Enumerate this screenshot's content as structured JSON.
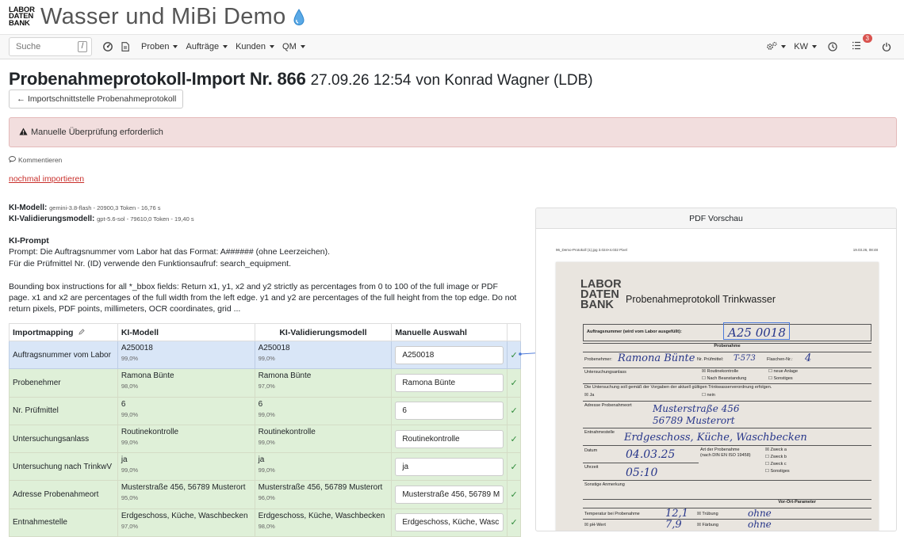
{
  "header": {
    "logo_line1": "LABOR",
    "logo_line2": "DATEN",
    "logo_line3": "BANK",
    "app_title": "Wasser und MiBi Demo"
  },
  "navbar": {
    "search_placeholder": "Suche",
    "search_key": "/",
    "menus": [
      "Proben",
      "Aufträge",
      "Kunden",
      "QM"
    ],
    "kw_label": "KW",
    "task_badge": "3",
    "icons": [
      "dashboard-icon",
      "document-icon",
      "settings-icon",
      "history-icon",
      "tasks-icon",
      "power-icon"
    ]
  },
  "page": {
    "title_main": "Probenahmeprotokoll-Import Nr. 866",
    "title_date": "27.09.26 12:54",
    "title_by": "von Konrad Wagner (LDB)",
    "back_button": "Importschnittstelle Probenahmeprotokoll",
    "alert_text": "Manuelle Überprüfung erforderlich",
    "comment_link": "Kommentieren",
    "reimport_link": "nochmal importieren"
  },
  "ai_info": {
    "model_label": "KI-Modell:",
    "model_value": "gemini-3.8-flash - 20900,3 Token - 16,76 s",
    "validation_label": "KI-Validierungsmodell:",
    "validation_value": "gpt-5.6-sol - 79610,0 Token - 19,40 s",
    "prompt_label": "KI-Prompt",
    "prompt_line1": "Prompt: Die Auftragsnummer vom Labor hat das Format: A###### (ohne Leerzeichen).",
    "prompt_line2": "Für die Prüfmittel Nr. (ID) verwende den Funktionsaufruf: search_equipment.",
    "prompt_line3": "Bounding box instructions for all *_bbox fields: Return x1, y1, x2 and y2 strictly as percentages from 0 to 100 of the full image or PDF page. x1 and x2 are percentages of the full width from the left edge. y1 and y2 are percentages of the full height from the top edge. Do not return pixels, PDF points, millimeters, OCR coordinates, grid ..."
  },
  "mapping_table": {
    "headers": [
      "Importmapping",
      "KI-Modell",
      "KI-Validierungsmodell",
      "Manuelle Auswahl"
    ],
    "rows": [
      {
        "field": "Auftragsnummer vom Labor",
        "model": "A250018",
        "model_pct": "99,0%",
        "val": "A250018",
        "val_pct": "99,0%",
        "manual": "A250018"
      },
      {
        "field": "Probenehmer",
        "model": "Ramona Bünte",
        "model_pct": "98,0%",
        "val": "Ramona Bünte",
        "val_pct": "97,0%",
        "manual": "Ramona Bünte"
      },
      {
        "field": "Nr. Prüfmittel",
        "model": "6",
        "model_pct": "99,0%",
        "val": "6",
        "val_pct": "99,0%",
        "manual": "6"
      },
      {
        "field": "Untersuchungsanlass",
        "model": "Routinekontrolle",
        "model_pct": "99,0%",
        "val": "Routinekontrolle",
        "val_pct": "99,0%",
        "manual": "Routinekontrolle"
      },
      {
        "field": "Untersuchung nach TrinkwV",
        "model": "ja",
        "model_pct": "99,0%",
        "val": "ja",
        "val_pct": "99,0%",
        "manual": "ja"
      },
      {
        "field": "Adresse Probenahmeort",
        "model": "Musterstraße 456, 56789 Musterort",
        "model_pct": "95,0%",
        "val": "Musterstraße 456, 56789 Musterort",
        "val_pct": "96,0%",
        "manual": "Musterstraße 456, 56789 M"
      },
      {
        "field": "Entnahmestelle",
        "model": "Erdgeschoss, Küche, Waschbecken",
        "model_pct": "97,0%",
        "val": "Erdgeschoss, Küche, Waschbecken",
        "val_pct": "98,0%",
        "manual": "Erdgeschoss, Küche, Wasc"
      }
    ]
  },
  "pdf_preview": {
    "heading": "PDF Vorschau",
    "file_label": "96_Demo-Protokoll (1).jpg 3.024×4.032 Pixel",
    "timestamp": "19.03.26, 08:48",
    "form_logo1": "LABOR",
    "form_logo2": "DATEN",
    "form_logo3": "BANK",
    "form_title": "Probenahmeprotokoll Trinkwasser",
    "order_label": "Auftragsnummer (wird vom Labor ausgefüllt):",
    "order_hand": "A25 0018",
    "section_probe": "Probenahme",
    "probenehmer_label": "Probenehmer:",
    "probenehmer_hand": "Ramona Bünte",
    "pruefmittel_label": "Nr. Prüfmittel:",
    "pruefmittel_hand": "T-573",
    "flaschen_label": "Flaschen-Nr.:",
    "flaschen_hand": "4",
    "anlass_label": "Untersuchungsanlass",
    "opt_routine": "Routinekontrolle",
    "opt_beanstandung": "Nach Beanstandung",
    "opt_neue": "neue Anlage",
    "opt_sonstiges": "Sonstiges",
    "trinkwv_text": "Die Untersuchung soll gemäß der Vorgaben der aktuell gültigen Trinkwasserverordnung erfolgen.",
    "ja_label": "Ja",
    "nein_label": "nein",
    "adresse_label": "Adresse Probenahmeort",
    "adresse_hand1": "Musterstraße 456",
    "adresse_hand2": "56789 Musterort",
    "entnahme_label": "Entnahmestelle",
    "entnahme_hand": "Erdgeschoss, Küche, Waschbecken",
    "datum_label": "Datum",
    "datum_hand": "04.03.25",
    "art_label": "Art der Probenahme",
    "art_label2": "(nach DIN EN ISO 19458)",
    "zweck_a": "Zweck a",
    "zweck_b": "Zweck b",
    "zweck_c": "Zweck c",
    "zweck_sonst": "Sonstiges",
    "uhrzeit_label": "Uhrzeit",
    "uhrzeit_hand": "05:10",
    "sonstige_label": "Sonstige Anmerkung",
    "vor_ort": "Vor-Ort-Parameter",
    "temp_label": "Temperatur bei Probenahme",
    "temp_hand": "12,1",
    "truebung_label": "Trübung",
    "truebung_hand": "ohne",
    "ph_label": "pH-Wert",
    "ph_hand": "7,9",
    "faerbung_label": "Färbung",
    "faerbung_hand": "ohne"
  }
}
